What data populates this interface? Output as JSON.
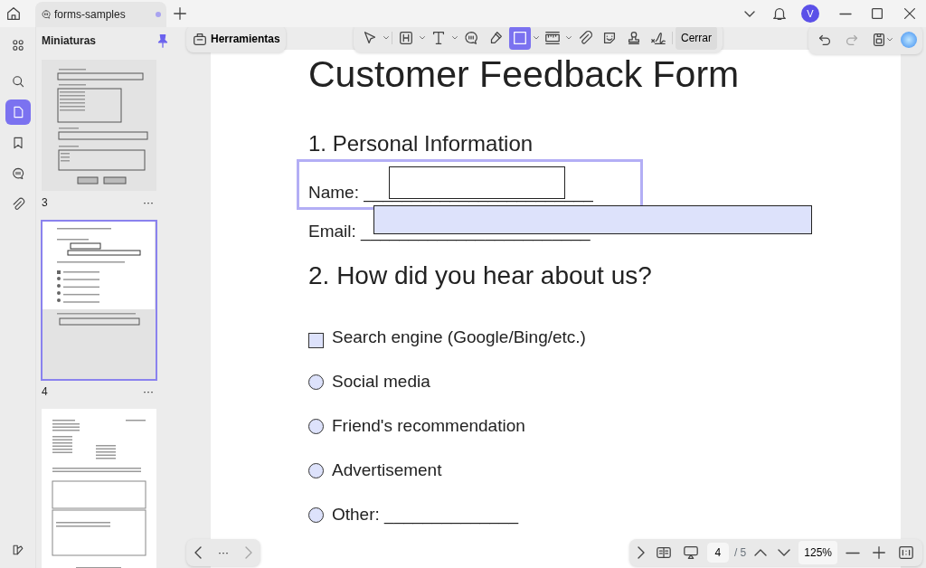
{
  "title_bar": {
    "tab": {
      "title": "forms-samples",
      "unsaved": true
    },
    "avatar": "V"
  },
  "rail": [
    {
      "kind": "apps",
      "selected": false
    },
    {
      "kind": "search",
      "selected": false
    },
    {
      "kind": "pages",
      "selected": true
    },
    {
      "kind": "bookmark",
      "selected": false
    },
    {
      "kind": "comment",
      "selected": false
    },
    {
      "kind": "attach",
      "selected": false
    },
    {
      "kind": "theme",
      "selected": false
    }
  ],
  "sidebar": {
    "title": "Miniaturas",
    "pinned": true,
    "thumbnails": [
      {
        "kind": "tasks-form",
        "label": "3",
        "menu": "···",
        "selected": false
      },
      {
        "kind": "feedback-form",
        "label": "4",
        "menu": "···",
        "selected": true
      },
      {
        "kind": "invoice",
        "selected": false
      }
    ]
  },
  "tools_button": "Herramientas",
  "toolbar": {
    "tools": [
      {
        "kind": "select",
        "dropdown": true,
        "selected": false
      },
      {
        "kind": "textbox",
        "dropdown": true,
        "selected": false
      },
      {
        "kind": "text",
        "dropdown": true,
        "selected": false
      },
      {
        "kind": "comment",
        "dropdown": false,
        "selected": false
      },
      {
        "kind": "highlight",
        "dropdown": false,
        "selected": false
      },
      {
        "kind": "rectangle",
        "dropdown": true,
        "selected": true
      },
      {
        "kind": "measure",
        "dropdown": true,
        "selected": false
      },
      {
        "kind": "attach",
        "dropdown": false,
        "selected": false
      },
      {
        "kind": "sticker",
        "dropdown": false,
        "selected": false
      },
      {
        "kind": "stamp",
        "dropdown": false,
        "selected": false
      },
      {
        "kind": "signature",
        "dropdown": false,
        "selected": false
      }
    ],
    "close": "Cerrar"
  },
  "document": {
    "title": "Customer Feedback Form",
    "section_1": "1. Personal Information",
    "fields": [
      {
        "label": "Name: ________________________",
        "annotation": {
          "selected": true,
          "filled": false
        }
      },
      {
        "label": "Email: ________________________",
        "annotation": {
          "selected": false,
          "filled": true
        }
      }
    ],
    "section_2": "2. How did you hear about us?",
    "options": [
      {
        "kind": "checkbox",
        "label": "Search engine (Google/Bing/etc.)",
        "checked": false
      },
      {
        "kind": "radio",
        "label": "Social media",
        "checked": false
      },
      {
        "kind": "radio",
        "label": "Friend's recommendation",
        "checked": false
      },
      {
        "kind": "radio",
        "label": "Advertisement",
        "checked": false
      },
      {
        "kind": "radio",
        "label": "Other: ______________",
        "checked": false
      }
    ]
  },
  "page_nav": {
    "more": "···"
  },
  "status": {
    "page": "4",
    "total": "/ 5",
    "zoom": "125%"
  }
}
